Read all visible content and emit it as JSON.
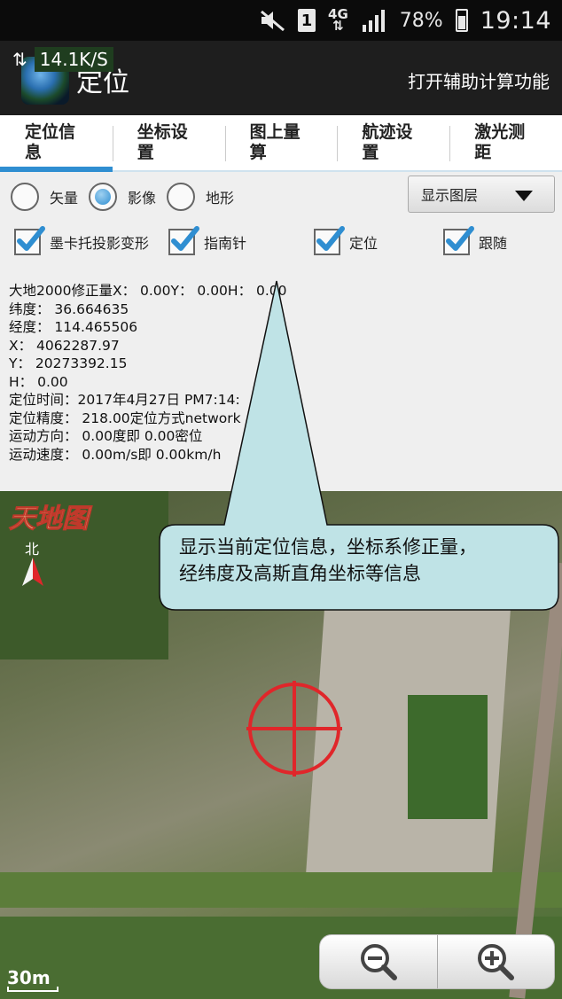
{
  "status_bar": {
    "sim_slot": "1",
    "network": "4G",
    "battery": "78%",
    "time": "19:14",
    "net_speed": "14.1K/S",
    "icons": [
      "mute-icon",
      "sim-icon",
      "network-icon",
      "signal-icon",
      "battery-icon"
    ]
  },
  "action_bar": {
    "title": "定位",
    "action": "打开辅助计算功能",
    "logo_icon": "globe-icon"
  },
  "tabs": [
    {
      "label": "定位信息",
      "active": true
    },
    {
      "label": "坐标设置",
      "active": false
    },
    {
      "label": "图上量算",
      "active": false
    },
    {
      "label": "航迹设置",
      "active": false
    },
    {
      "label": "激光测距",
      "active": false
    }
  ],
  "map_type": {
    "options": [
      "矢量",
      "影像",
      "地形"
    ],
    "selected": "影像"
  },
  "layer_button": "显示图层",
  "checkboxes": [
    {
      "label": "墨卡托投影变形",
      "checked": true
    },
    {
      "label": "指南针",
      "checked": true
    },
    {
      "label": "定位",
      "checked": true
    },
    {
      "label": "跟随",
      "checked": true
    }
  ],
  "info_lines": [
    "大地2000修正量X： 0.00Y： 0.00H： 0.00",
    "纬度： 36.664635",
    "经度： 114.465506",
    "X： 4062287.97",
    "Y： 20273392.15",
    "H： 0.00",
    "定位时间：2017年4月27日 PM7:14:",
    "定位精度： 218.00定位方式network",
    "运动方向： 0.00度即 0.00密位",
    "运动速度： 0.00m/s即 0.00km/h"
  ],
  "map": {
    "brand": "天地图",
    "north_label": "北",
    "scale": "30m",
    "zoom_out_icon": "zoom-out-icon",
    "zoom_in_icon": "zoom-in-icon"
  },
  "callout": {
    "line1": "显示当前定位信息，坐标系修正量，",
    "line2": "经纬度及高斯直角坐标等信息",
    "fill": "#bfe3e6"
  },
  "colors": {
    "accent": "#2f8ed1",
    "crosshair": "#e0262a"
  }
}
